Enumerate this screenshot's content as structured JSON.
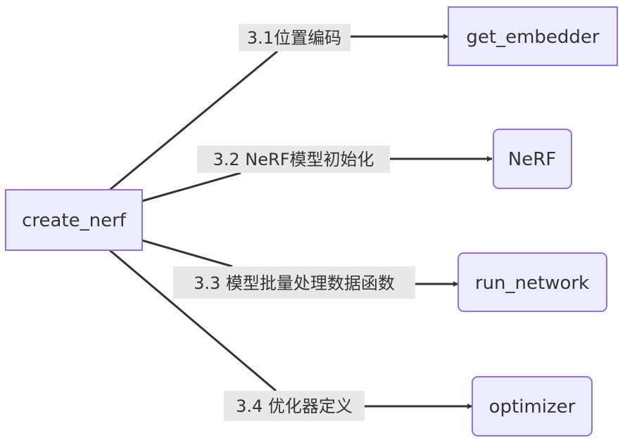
{
  "nodes": {
    "root": "create_nerf",
    "embedder": "get_embedder",
    "nerf": "NeRF",
    "run_network": "run_network",
    "optimizer": "optimizer"
  },
  "edges": {
    "e1": "3.1位置编码",
    "e2": "3.2 NeRF模型初始化",
    "e3": "3.3 模型批量处理数据函数",
    "e4": "3.4 优化器定义"
  },
  "colors": {
    "node_fill": "#ECECFF",
    "node_border": "#9370DB",
    "edge": "#333333",
    "label_bg": "#E8E8E8"
  }
}
